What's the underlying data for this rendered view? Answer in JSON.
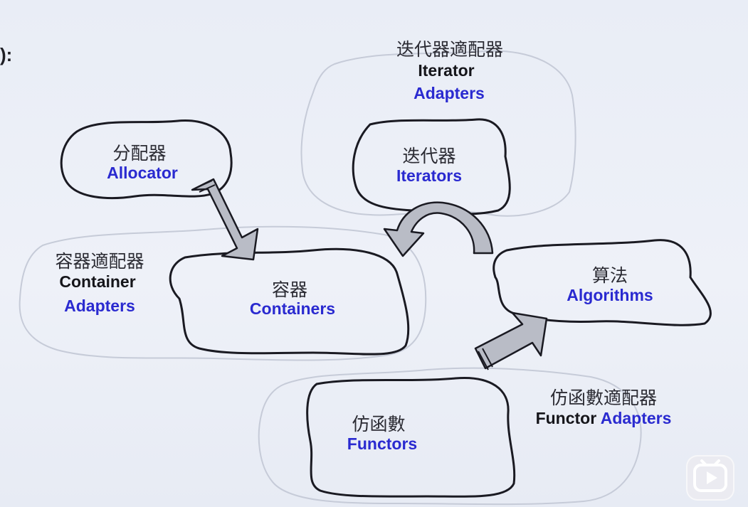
{
  "corner_text": "):",
  "nodes": {
    "allocator": {
      "zh": "分配器",
      "en": "Allocator"
    },
    "iterator_adapters": {
      "zh": "迭代器適配器",
      "en_line1": "Iterator",
      "en_line2": "Adapters"
    },
    "iterators": {
      "zh": "迭代器",
      "en": "Iterators"
    },
    "container_adapters": {
      "zh": "容器適配器",
      "en_line1": "Container",
      "en_line2": "Adapters"
    },
    "containers": {
      "zh": "容器",
      "en": "Containers"
    },
    "algorithms": {
      "zh": "算法",
      "en": "Algorithms"
    },
    "functors": {
      "zh": "仿函數",
      "en": "Functors"
    },
    "functor_adapters": {
      "zh": "仿函數適配器",
      "en_part1": "Functor",
      "en_part2": "Adapters"
    }
  },
  "edges": [
    {
      "from": "allocator",
      "to": "containers"
    },
    {
      "from": "algorithms",
      "to": "containers",
      "via": "iterators"
    },
    {
      "from": "functors",
      "to": "algorithms"
    }
  ],
  "colors": {
    "label_blue": "#2a2ad0",
    "label_black": "#15151a",
    "arrow_fill": "#b9bcc6"
  },
  "icons": {
    "player_button": "play-icon"
  }
}
